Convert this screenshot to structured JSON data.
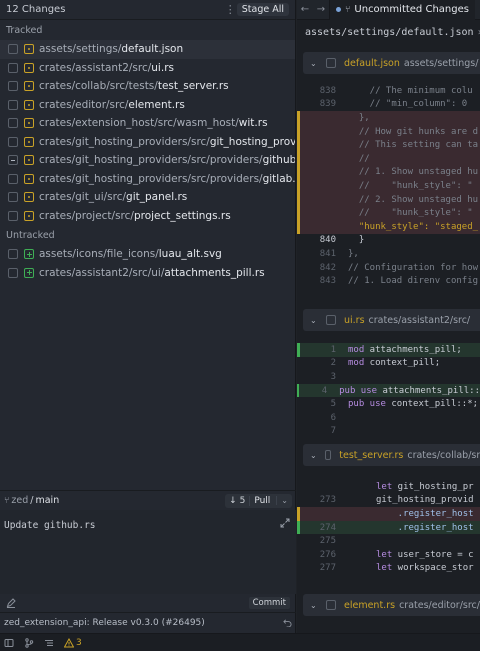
{
  "left_panel": {
    "changes_count": "12 Changes",
    "stage_all_label": "Stage All",
    "tracked_label": "Tracked",
    "untracked_label": "Untracked",
    "tracked_files": [
      {
        "dir": "assets/settings/",
        "name": "default.json",
        "status": "modified",
        "checkbox": "unchecked",
        "selected": true
      },
      {
        "dir": "crates/assistant2/src/",
        "name": "ui.rs",
        "status": "modified",
        "checkbox": "unchecked"
      },
      {
        "dir": "crates/collab/src/tests/",
        "name": "test_server.rs",
        "status": "modified",
        "checkbox": "unchecked"
      },
      {
        "dir": "crates/editor/src/",
        "name": "element.rs",
        "status": "modified",
        "checkbox": "unchecked"
      },
      {
        "dir": "crates/extension_host/src/wasm_host/",
        "name": "wit.rs",
        "status": "modified",
        "checkbox": "unchecked"
      },
      {
        "dir": "crates/git_hosting_providers/src/",
        "name": "git_hosting_providers.rs",
        "status": "modified",
        "checkbox": "unchecked"
      },
      {
        "dir": "crates/git_hosting_providers/src/providers/",
        "name": "github.rs",
        "status": "modified",
        "checkbox": "partial"
      },
      {
        "dir": "crates/git_hosting_providers/src/providers/",
        "name": "gitlab.rs",
        "status": "modified",
        "checkbox": "unchecked"
      },
      {
        "dir": "crates/git_ui/src/",
        "name": "git_panel.rs",
        "status": "modified",
        "checkbox": "unchecked"
      },
      {
        "dir": "crates/project/src/",
        "name": "project_settings.rs",
        "status": "modified",
        "checkbox": "unchecked"
      }
    ],
    "untracked_files": [
      {
        "dir": "assets/icons/file_icons/",
        "name": "luau_alt.svg",
        "status": "added",
        "checkbox": "unchecked"
      },
      {
        "dir": "crates/assistant2/src/ui/",
        "name": "attachments_pill.rs",
        "status": "added",
        "checkbox": "unchecked"
      }
    ],
    "branch": {
      "repo": "zed",
      "separator": "/",
      "name": "main"
    },
    "pull": {
      "count": "5",
      "label": "Pull"
    },
    "commit_message": "Update github.rs",
    "commit_button": "Commit",
    "last_commit": "zed_extension_api: Release v0.3.0 (#26495)"
  },
  "status_bar": {
    "warnings": "3"
  },
  "right_panel": {
    "tab_title": "Uncommitted Changes",
    "breadcrumb_path": "assets/settings/default.json",
    "breadcrumb_sep": "›",
    "breadcrumb_next": "git",
    "files": [
      {
        "name": "default.json",
        "dir": "assets/settings/"
      },
      {
        "name": "ui.rs",
        "dir": "crates/assistant2/src/"
      },
      {
        "name": "test_server.rs",
        "dir": "crates/collab/src/tes"
      },
      {
        "name": "element.rs",
        "dir": "crates/editor/src/"
      }
    ],
    "hunk1": [
      {
        "ln": "838",
        "text": "    // The minimum colu",
        "kind": "ctx"
      },
      {
        "ln": "839",
        "text": "    // \"min_column\": 0",
        "kind": "ctx"
      },
      {
        "ln": "",
        "text": "  },",
        "kind": "del"
      },
      {
        "ln": "",
        "text": "  // How git hunks are d",
        "kind": "del"
      },
      {
        "ln": "",
        "text": "  // This setting can ta",
        "kind": "del"
      },
      {
        "ln": "",
        "text": "  //",
        "kind": "del"
      },
      {
        "ln": "",
        "text": "  // 1. Show unstaged hu",
        "kind": "del"
      },
      {
        "ln": "",
        "text": "  //    \"hunk_style\": \"",
        "kind": "del"
      },
      {
        "ln": "",
        "text": "  // 2. Show unstaged hu",
        "kind": "del"
      },
      {
        "ln": "",
        "text": "  //    \"hunk_style\": \"",
        "kind": "del"
      },
      {
        "ln": "",
        "text": "  \"hunk_style\": \"staged_",
        "kind": "delstr"
      },
      {
        "ln": "840",
        "text": "  }",
        "kind": "cur"
      },
      {
        "ln": "841",
        "text": "},",
        "kind": "ctx"
      },
      {
        "ln": "842",
        "text": "// Configuration for how",
        "kind": "ctx"
      },
      {
        "ln": "843",
        "text": "// 1. Load direnv config",
        "kind": "ctx"
      }
    ],
    "hunk2": [
      {
        "ln": "1",
        "kw": "mod",
        "rest": " attachments_pill;",
        "kind": "add"
      },
      {
        "ln": "2",
        "kw": "mod",
        "rest": " context_pill;",
        "kind": "plain"
      },
      {
        "ln": "3",
        "kw": "",
        "rest": "",
        "kind": "plain"
      },
      {
        "ln": "4",
        "kw": "pub use",
        "rest": " attachments_pill::",
        "kind": "add"
      },
      {
        "ln": "5",
        "kw": "pub use",
        "rest": " context_pill::*;",
        "kind": "plain"
      },
      {
        "ln": "6",
        "kw": "",
        "rest": "",
        "kind": "plain"
      },
      {
        "ln": "7",
        "kw": "",
        "rest": "",
        "kind": "plain"
      }
    ],
    "hunk3": [
      {
        "ln": "",
        "kw": "let",
        "rest": " git_hosting_pr",
        "kind": "plain"
      },
      {
        "ln": "273",
        "kw": "",
        "rest": "git_hosting_provid",
        "kind": "plain"
      },
      {
        "ln": "",
        "kw": "",
        "rest": "    .register_host",
        "kind": "del"
      },
      {
        "ln": "274",
        "kw": "",
        "rest": "    .register_host",
        "kind": "add"
      },
      {
        "ln": "275",
        "kw": "",
        "rest": "",
        "kind": "plain"
      },
      {
        "ln": "276",
        "kw": "let",
        "rest": " user_store = c",
        "kind": "plain"
      },
      {
        "ln": "277",
        "kw": "let",
        "rest": " workspace_stor",
        "kind": "plain"
      }
    ]
  }
}
